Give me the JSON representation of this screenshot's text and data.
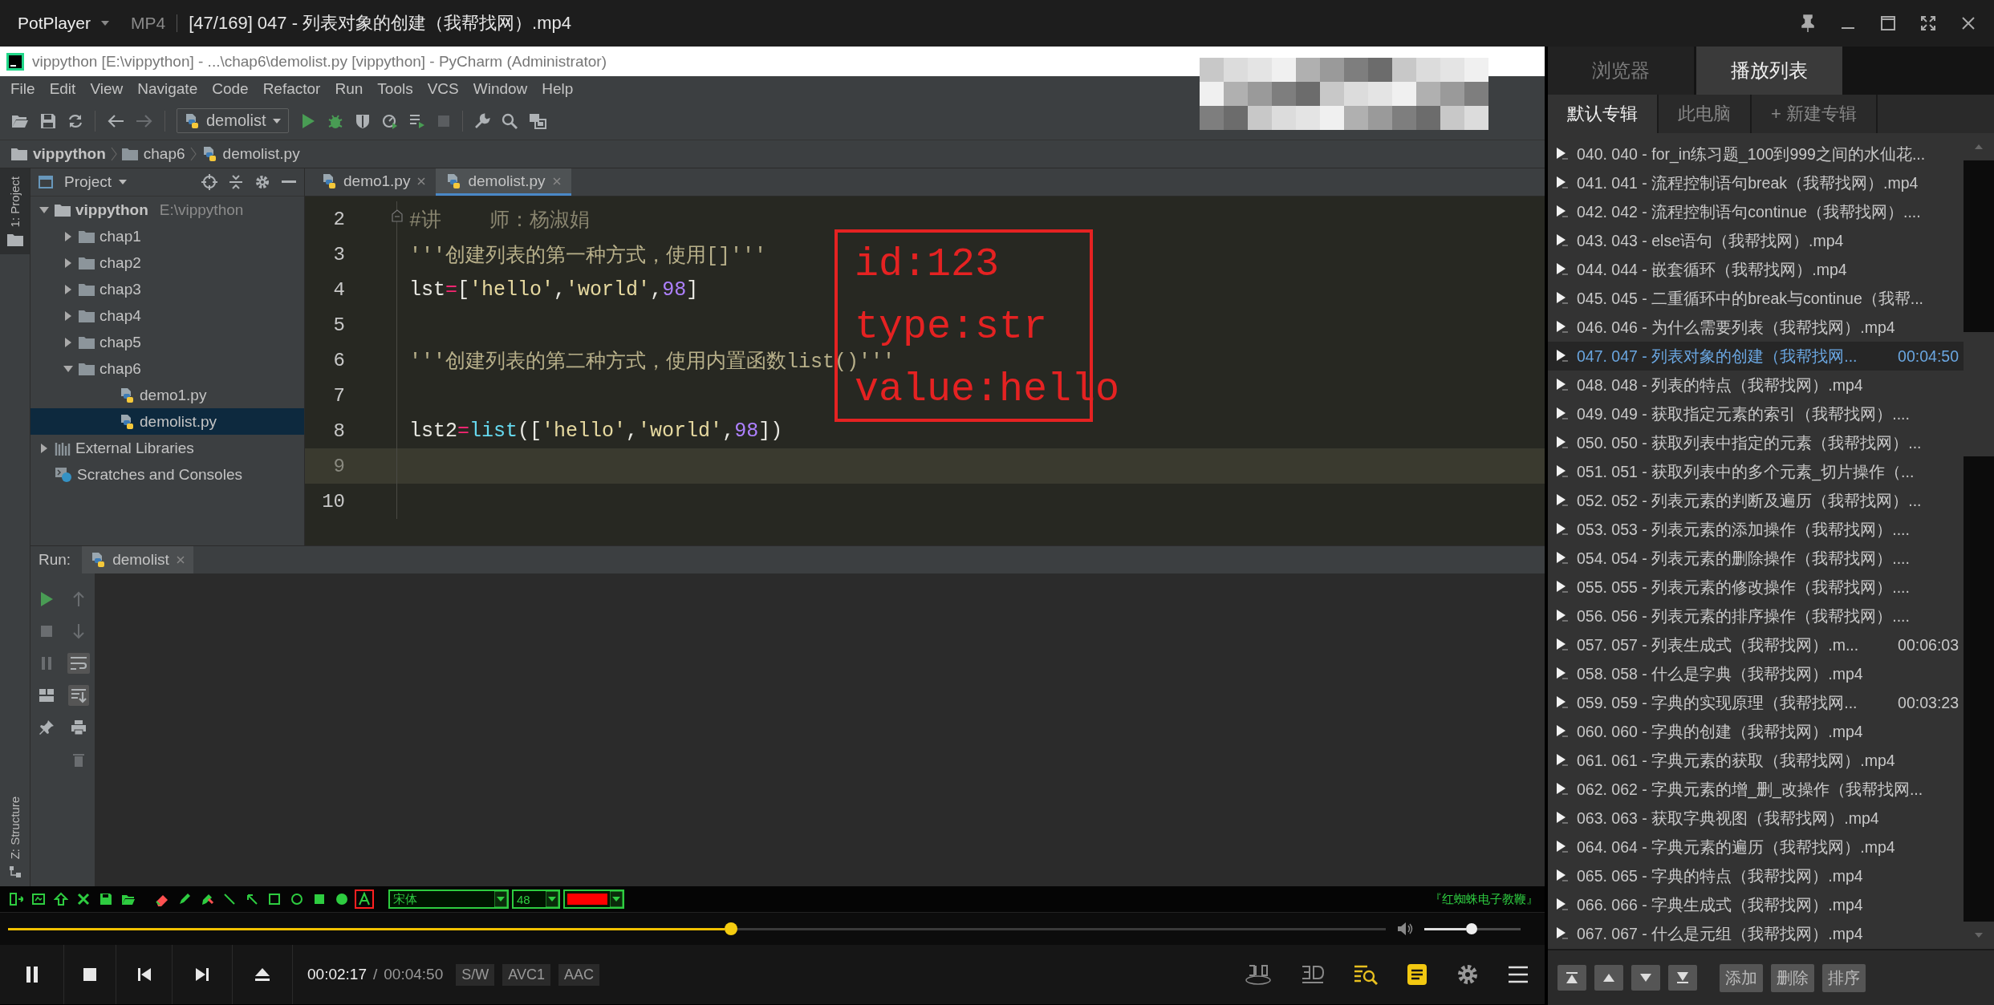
{
  "player": {
    "app_name": "PotPlayer",
    "format": "MP4",
    "title": "[47/169] 047 - 列表对象的创建（我帮找网）.mp4"
  },
  "ide": {
    "window_title": "vippython [E:\\vippython] - ...\\chap6\\demolist.py [vippython] - PyCharm (Administrator)",
    "menu": [
      "File",
      "Edit",
      "View",
      "Navigate",
      "Code",
      "Refactor",
      "Run",
      "Tools",
      "VCS",
      "Window",
      "Help"
    ],
    "run_config": "demolist",
    "breadcrumb": [
      {
        "label": "vippython",
        "kind": "project"
      },
      {
        "label": "chap6",
        "kind": "folder"
      },
      {
        "label": "demolist.py",
        "kind": "file"
      }
    ],
    "side_tabs": [
      {
        "label": "1: Project",
        "selected": true
      },
      {
        "label": "Z: Structure",
        "selected": false
      }
    ],
    "project_panel": {
      "title": "Project",
      "tree": [
        {
          "label": "vippython",
          "path": "E:\\vippython",
          "kind": "project",
          "expanded": true,
          "selected": false,
          "children": [
            {
              "label": "chap1",
              "kind": "folder",
              "expanded": false,
              "selected": false
            },
            {
              "label": "chap2",
              "kind": "folder",
              "expanded": false,
              "selected": false
            },
            {
              "label": "chap3",
              "kind": "folder",
              "expanded": false,
              "selected": false
            },
            {
              "label": "chap4",
              "kind": "folder",
              "expanded": false,
              "selected": false
            },
            {
              "label": "chap5",
              "kind": "folder",
              "expanded": false,
              "selected": false
            },
            {
              "label": "chap6",
              "kind": "folder",
              "expanded": true,
              "selected": false,
              "children": [
                {
                  "label": "demo1.py",
                  "kind": "file",
                  "selected": false
                },
                {
                  "label": "demolist.py",
                  "kind": "file",
                  "selected": true
                }
              ]
            }
          ]
        },
        {
          "label": "External Libraries",
          "kind": "library",
          "expanded": false,
          "selected": false
        },
        {
          "label": "Scratches and Consoles",
          "kind": "scratches",
          "selected": false
        }
      ]
    },
    "editor": {
      "tabs": [
        {
          "label": "demo1.py",
          "selected": false
        },
        {
          "label": "demolist.py",
          "selected": true
        }
      ],
      "lines": [
        {
          "number": "2",
          "current": false,
          "tokens": [
            {
              "kind": "comment",
              "text": "#讲    师：杨淑娟"
            }
          ]
        },
        {
          "number": "3",
          "current": false,
          "tokens": [
            {
              "kind": "doc",
              "text": "'''创建列表的第一种方式，使用[]'''"
            }
          ]
        },
        {
          "number": "4",
          "current": false,
          "tokens": [
            {
              "kind": "plain",
              "text": "lst"
            },
            {
              "kind": "op",
              "text": "="
            },
            {
              "kind": "plain",
              "text": "["
            },
            {
              "kind": "str",
              "text": "'hello'"
            },
            {
              "kind": "plain",
              "text": ","
            },
            {
              "kind": "str",
              "text": "'world'"
            },
            {
              "kind": "plain",
              "text": ","
            },
            {
              "kind": "num",
              "text": "98"
            },
            {
              "kind": "plain",
              "text": "]"
            }
          ]
        },
        {
          "number": "5",
          "current": false
        },
        {
          "number": "6",
          "current": false,
          "tokens": [
            {
              "kind": "doc",
              "text": "'''创建列表的第二种方式，使用内置函数list()'''"
            }
          ]
        },
        {
          "number": "7",
          "current": false
        },
        {
          "number": "8",
          "current": false,
          "tokens": [
            {
              "kind": "plain",
              "text": "lst2"
            },
            {
              "kind": "op",
              "text": "="
            },
            {
              "kind": "builtin",
              "text": "list"
            },
            {
              "kind": "plain",
              "text": "(["
            },
            {
              "kind": "str",
              "text": "'hello'"
            },
            {
              "kind": "plain",
              "text": ","
            },
            {
              "kind": "str",
              "text": "'world'"
            },
            {
              "kind": "plain",
              "text": ","
            },
            {
              "kind": "num",
              "text": "98"
            },
            {
              "kind": "plain",
              "text": "])"
            }
          ]
        },
        {
          "number": "9",
          "current": true
        },
        {
          "number": "10",
          "current": false
        }
      ]
    },
    "annotation": {
      "lines": [
        "id:123",
        "type:str",
        "value:hello"
      ]
    },
    "run_panel": {
      "label": "Run:",
      "tabs": [
        {
          "label": "demolist",
          "selected": true
        }
      ]
    }
  },
  "drawing_toolbar": {
    "tools": [
      {
        "kind": "exit",
        "selected": false
      },
      {
        "kind": "whiteboard",
        "selected": false
      },
      {
        "kind": "undo",
        "selected": false
      },
      {
        "kind": "clear",
        "selected": false
      },
      {
        "kind": "save",
        "selected": false
      },
      {
        "kind": "open",
        "selected": false
      },
      {
        "kind": "eraser",
        "selected": false
      },
      {
        "kind": "pen",
        "selected": false
      },
      {
        "kind": "marker",
        "selected": false
      },
      {
        "kind": "line",
        "selected": false
      },
      {
        "kind": "arrow",
        "selected": false
      },
      {
        "kind": "rectangle",
        "selected": false
      },
      {
        "kind": "ellipse",
        "selected": false
      },
      {
        "kind": "filled-rectangle",
        "selected": false
      },
      {
        "kind": "filled-ellipse",
        "selected": false
      },
      {
        "kind": "text",
        "selected": true
      }
    ],
    "font": "宋体",
    "size": "48",
    "color": "#ff0000",
    "brand": "『红蜘蛛电子教鞭』"
  },
  "playback": {
    "level": 0.52,
    "playing": true,
    "volume": {
      "level": 0.43
    },
    "elapsed": "00:02:17",
    "separator": "/",
    "duration": "00:04:50",
    "badges": [
      "S/W",
      "AVC1",
      "AAC"
    ]
  },
  "playlist": {
    "tabs": [
      {
        "label": "浏览器",
        "selected": false
      },
      {
        "label": "播放列表",
        "selected": true
      }
    ],
    "albums": [
      {
        "label": "默认专辑",
        "selected": true
      },
      {
        "label": "此电脑",
        "selected": false
      },
      {
        "label": "+ 新建专辑",
        "selected": false
      }
    ],
    "items": [
      {
        "title": "040. 040 - for_in练习题_100到999之间的水仙花...",
        "selected": false
      },
      {
        "title": "041. 041 - 流程控制语句break（我帮找网）.mp4",
        "selected": false
      },
      {
        "title": "042. 042 - 流程控制语句continue（我帮找网）....",
        "selected": false
      },
      {
        "title": "043. 043 - else语句（我帮找网）.mp4",
        "selected": false
      },
      {
        "title": "044. 044 - 嵌套循环（我帮找网）.mp4",
        "selected": false
      },
      {
        "title": "045. 045 - 二重循环中的break与continue（我帮...",
        "selected": false
      },
      {
        "title": "046. 046 - 为什么需要列表（我帮找网）.mp4",
        "selected": false
      },
      {
        "title": "047. 047 - 列表对象的创建（我帮找网...",
        "duration": "00:04:50",
        "selected": true
      },
      {
        "title": "048. 048 - 列表的特点（我帮找网）.mp4",
        "selected": false
      },
      {
        "title": "049. 049 - 获取指定元素的索引（我帮找网）....",
        "selected": false
      },
      {
        "title": "050. 050 - 获取列表中指定的元素（我帮找网）...",
        "selected": false
      },
      {
        "title": "051. 051 - 获取列表中的多个元素_切片操作（...",
        "selected": false
      },
      {
        "title": "052. 052 - 列表元素的判断及遍历（我帮找网）...",
        "selected": false
      },
      {
        "title": "053. 053 - 列表元素的添加操作（我帮找网）....",
        "selected": false
      },
      {
        "title": "054. 054 - 列表元素的删除操作（我帮找网）....",
        "selected": false
      },
      {
        "title": "055. 055 - 列表元素的修改操作（我帮找网）....",
        "selected": false
      },
      {
        "title": "056. 056 - 列表元素的排序操作（我帮找网）....",
        "selected": false
      },
      {
        "title": "057. 057 - 列表生成式（我帮找网）.m...",
        "duration": "00:06:03",
        "selected": false
      },
      {
        "title": "058. 058 - 什么是字典（我帮找网）.mp4",
        "selected": false
      },
      {
        "title": "059. 059 - 字典的实现原理（我帮找网...",
        "duration": "00:03:23",
        "selected": false
      },
      {
        "title": "060. 060 - 字典的创建（我帮找网）.mp4",
        "selected": false
      },
      {
        "title": "061. 061 - 字典元素的获取（我帮找网）.mp4",
        "selected": false
      },
      {
        "title": "062. 062 - 字典元素的增_删_改操作（我帮找网...",
        "selected": false
      },
      {
        "title": "063. 063 - 获取字典视图（我帮找网）.mp4",
        "selected": false
      },
      {
        "title": "064. 064 - 字典元素的遍历（我帮找网）.mp4",
        "selected": false
      },
      {
        "title": "065. 065 - 字典的特点（我帮找网）.mp4",
        "selected": false
      },
      {
        "title": "066. 066 - 字典生成式（我帮找网）.mp4",
        "selected": false
      },
      {
        "title": "067. 067 - 什么是元组（我帮找网）.mp4",
        "selected": false
      }
    ],
    "buttons": [
      "添加",
      "删除",
      "排序"
    ]
  }
}
